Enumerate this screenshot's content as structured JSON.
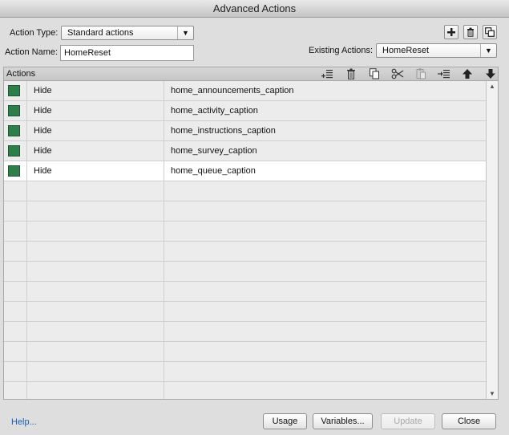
{
  "window": {
    "title": "Advanced Actions"
  },
  "action_type": {
    "label": "Action Type:",
    "value": "Standard actions"
  },
  "action_name": {
    "label": "Action Name:",
    "value": "HomeReset"
  },
  "existing_actions": {
    "label": "Existing Actions:",
    "value": "HomeReset"
  },
  "actions_panel": {
    "title": "Actions"
  },
  "rows": [
    {
      "command": "Hide",
      "target": "home_announcements_caption",
      "color": "#2e7d4a"
    },
    {
      "command": "Hide",
      "target": "home_activity_caption",
      "color": "#2e7d4a"
    },
    {
      "command": "Hide",
      "target": "home_instructions_caption",
      "color": "#2e7d4a"
    },
    {
      "command": "Hide",
      "target": "home_survey_caption",
      "color": "#2e7d4a"
    },
    {
      "command": "Hide",
      "target": "home_queue_caption",
      "color": "#2e7d4a"
    }
  ],
  "footer": {
    "help": "Help...",
    "usage": "Usage",
    "variables": "Variables...",
    "update": "Update",
    "close": "Close"
  },
  "icons": {
    "header": [
      "plus-icon",
      "trash-icon",
      "duplicate-icon"
    ],
    "toolbar": [
      "add-row-icon",
      "delete-icon",
      "copy-icon",
      "cut-icon",
      "paste-icon",
      "insert-icon",
      "move-up-icon",
      "move-down-icon"
    ]
  }
}
